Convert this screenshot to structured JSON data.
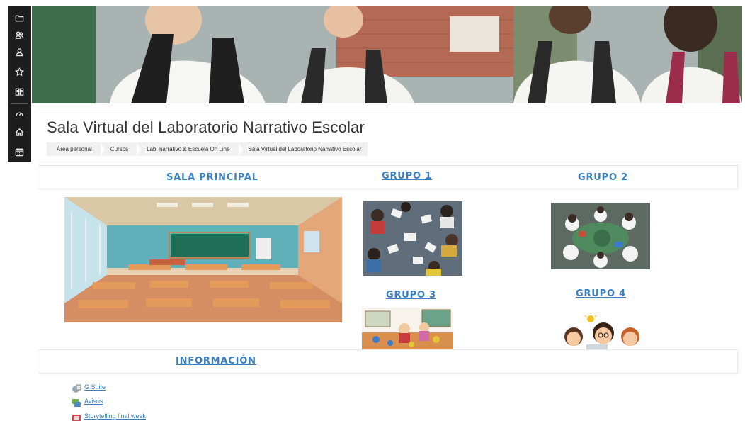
{
  "sidebar": {
    "items": [
      {
        "name": "folder-icon"
      },
      {
        "name": "users-icon"
      },
      {
        "name": "user-icon"
      },
      {
        "name": "star-icon"
      },
      {
        "name": "book-icon"
      },
      {
        "name": "gauge-icon"
      },
      {
        "name": "home-icon"
      },
      {
        "name": "calendar-icon"
      }
    ]
  },
  "header": {
    "title": "Sala Virtual del Laboratorio Narrativo Escolar",
    "breadcrumb": [
      "Área personal",
      "Cursos",
      "Lab. narrativo & Escuela On Line",
      "Sala Virtual del Laboratorio Narrativo Escolar"
    ]
  },
  "sections": {
    "sala_principal": "SALA PRINCIPAL",
    "grupo1": "GRUPO 1",
    "grupo2": "GRUPO 2",
    "grupo3": "GRUPO 3",
    "grupo4": "GRUPO 4",
    "informacion": "INFORMACIÓN"
  },
  "info": {
    "items": [
      {
        "label": "G Suite",
        "icon": "gsuite-icon"
      },
      {
        "label": "Avisos",
        "icon": "forum-icon"
      },
      {
        "label": "Storytelling final week",
        "icon": "video-icon"
      }
    ]
  },
  "colors": {
    "link": "#3a7ebf",
    "sidebar_bg": "#1d1d1d",
    "title": "#333333"
  }
}
